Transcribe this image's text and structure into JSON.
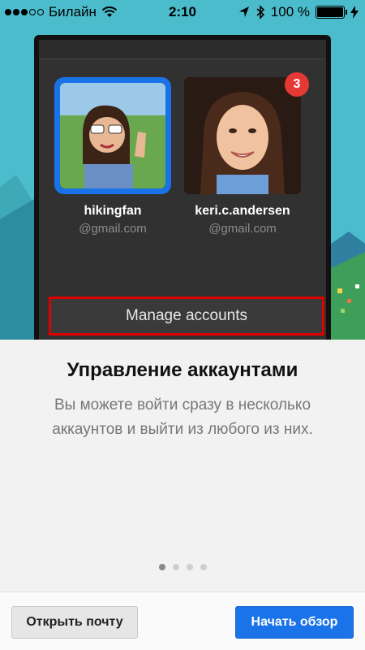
{
  "status_bar": {
    "carrier": "Билайн",
    "time": "2:10",
    "battery": "100 %"
  },
  "accounts": [
    {
      "name": "hikingfan",
      "domain": "@gmail.com",
      "selected": true,
      "badge": ""
    },
    {
      "name": "keri.c.andersen",
      "domain": "@gmail.com",
      "selected": false,
      "badge": "3"
    }
  ],
  "manage_accounts_label": "Manage accounts",
  "title": "Управление аккаунтами",
  "description": "Вы можете войти сразу в несколько аккаунтов и выйти из любого из них.",
  "pagination": {
    "total": 4,
    "current": 1
  },
  "buttons": {
    "open_mail": "Открыть почту",
    "start_tour": "Начать обзор"
  },
  "colors": {
    "accent": "#1a73e8",
    "highlight_border": "#e10000",
    "badge": "#e53935"
  }
}
